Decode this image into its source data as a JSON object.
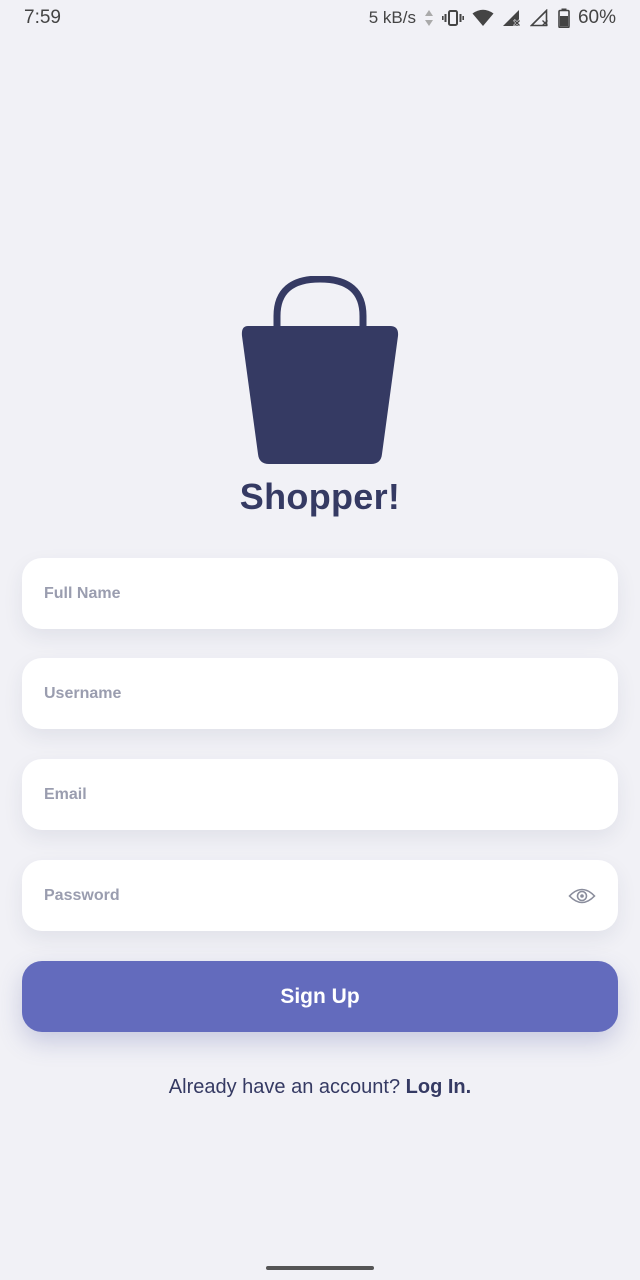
{
  "status_bar": {
    "time": "7:59",
    "network_speed": "5 kB/s",
    "battery_percent": "60%",
    "icons": [
      "data-arrows-icon",
      "vibrate-icon",
      "wifi-icon",
      "signal-icon",
      "signal-off-icon",
      "battery-icon"
    ]
  },
  "logo": {
    "icon": "shopping-bag-icon",
    "app_name": "Shopper!"
  },
  "form": {
    "full_name_placeholder": "Full Name",
    "username_placeholder": "Username",
    "email_placeholder": "Email",
    "password_placeholder": "Password",
    "password_toggle_icon": "eye-icon",
    "signup_label": "Sign Up"
  },
  "footer": {
    "prompt": "Already have an account?",
    "login_label": "Log In."
  },
  "colors": {
    "background": "#f1f1f6",
    "primary_dark": "#353a63",
    "button": "#636bbd",
    "placeholder": "#9a9daf"
  }
}
